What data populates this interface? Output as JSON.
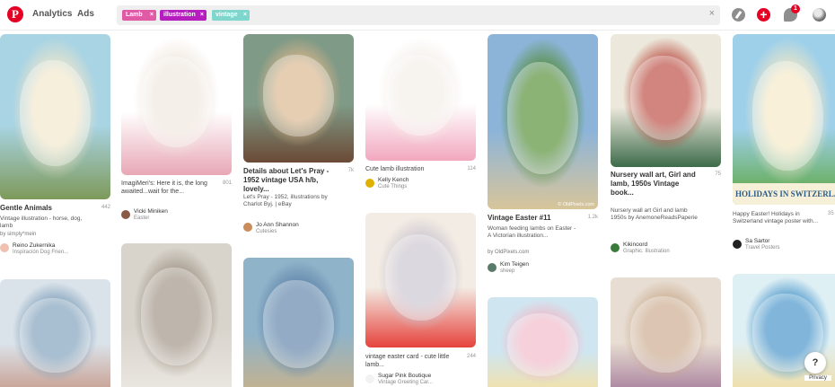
{
  "nav": {
    "analytics": "Analytics",
    "ads": "Ads"
  },
  "search": {
    "chips": [
      {
        "label": "Lamb",
        "color": "#e05aa6"
      },
      {
        "label": "illustration",
        "color": "#b61dbf"
      },
      {
        "label": "vintage",
        "color": "#7fd6cc"
      }
    ],
    "chip_remove": "×",
    "clear": "×"
  },
  "header_icons": {
    "plus": "+",
    "notification_count": "1"
  },
  "pins": [
    {
      "title": "Gentle Animals",
      "saves": "442",
      "desc": "Vintage illustration - horse, dog, lamb",
      "by": "by simply*mein",
      "user": "Reino Zukernika",
      "board": "Inspiración Dog Frien...",
      "img": [
        "#a9d4e4",
        "#f2e6c9",
        "#7d9a5a"
      ],
      "avatar": "#f0c0b0"
    },
    {
      "title": "ImagiMeri's: Here it is, the long awaited...wait for the...",
      "saves": "801",
      "user": "Vicki Miniken",
      "board": "Easter",
      "img": [
        "#ffffff",
        "#efe6dc",
        "#e8a7b6"
      ],
      "avatar": "#8a5a44"
    },
    {
      "title": "Details about Let's Pray - 1952 vintage USA h/b, lovely...",
      "saves": "7k",
      "desc": "Let's Pray - 1952, illustrations by Charlot Byj. | eBay",
      "user": "Jo Ann Shannon",
      "board": "Cutesies",
      "img": [
        "#7f9a86",
        "#d9b48a",
        "#6b4a36"
      ],
      "avatar": "#c98c5a"
    },
    {
      "title": "Cute lamb illustration",
      "saves": "114",
      "user": "Kelly Kench",
      "board": "Cute Things",
      "img": [
        "#ffffff",
        "#f3eee8",
        "#f2a7bf"
      ],
      "avatar": "#e0b100"
    },
    {
      "title": "Vintage Easter #11",
      "saves": "1.2k",
      "desc": "Woman feeding lambs on Easter - A Victorian illustration...",
      "by": "by OldPixels.com",
      "user": "Kim Teigen",
      "board": "sheep",
      "watermark": "© OldPixels.com",
      "img": [
        "#8cb4d9",
        "#4f8a2d",
        "#d8c59a"
      ],
      "avatar": "#5a7a6a"
    },
    {
      "title": "Nursery wall art, Girl and lamb, 1950s Vintage book...",
      "saves": "75",
      "desc": "Nursery wall art Girl and lamb 1950s by AnemoneReadsPaperie",
      "user": "Kikinoord",
      "board": "Graphic. Illustration",
      "img": [
        "#ece9dc",
        "#b8443a",
        "#3d6b4a"
      ],
      "avatar": "#3a7a3a"
    },
    {
      "title": "Happy Easter! Holidays in Switzerland vintage poster with...",
      "saves": "35",
      "poster_text": "HOLIDAYS IN SWITZERLAND",
      "user": "Sa Sartor",
      "board": "Travel Posters",
      "img": [
        "#9fd0ea",
        "#f4e8c4",
        "#5aa53a"
      ],
      "avatar": "#222222"
    },
    {
      "img": [
        "#dbe3ea",
        "#7a9cb8",
        "#c79a8a"
      ]
    },
    {
      "img": [
        "#d8d4cc",
        "#9b8f80",
        "#ece8e2"
      ]
    },
    {
      "img": [
        "#8fb3c9",
        "#5a7fa6",
        "#c9b28a"
      ]
    },
    {
      "title": "vintage easter card - cute little lamb...",
      "saves": "244",
      "user": "Sugar Pink Boutique",
      "board": "Vintage Greeting Car...",
      "img": [
        "#f3ece4",
        "#c8c3cf",
        "#e6423c"
      ],
      "avatar": "#f2f2f2"
    },
    {
      "img": [
        "#cfe6f1",
        "#f2b8c8",
        "#f6e0a0"
      ]
    },
    {
      "img": [
        "#e7ddd2",
        "#c9a88a",
        "#a47a9a"
      ]
    },
    {
      "img": [
        "#dff0f5",
        "#3e8fc7",
        "#f1dca0"
      ]
    }
  ],
  "help": "?",
  "privacy": "Privacy"
}
